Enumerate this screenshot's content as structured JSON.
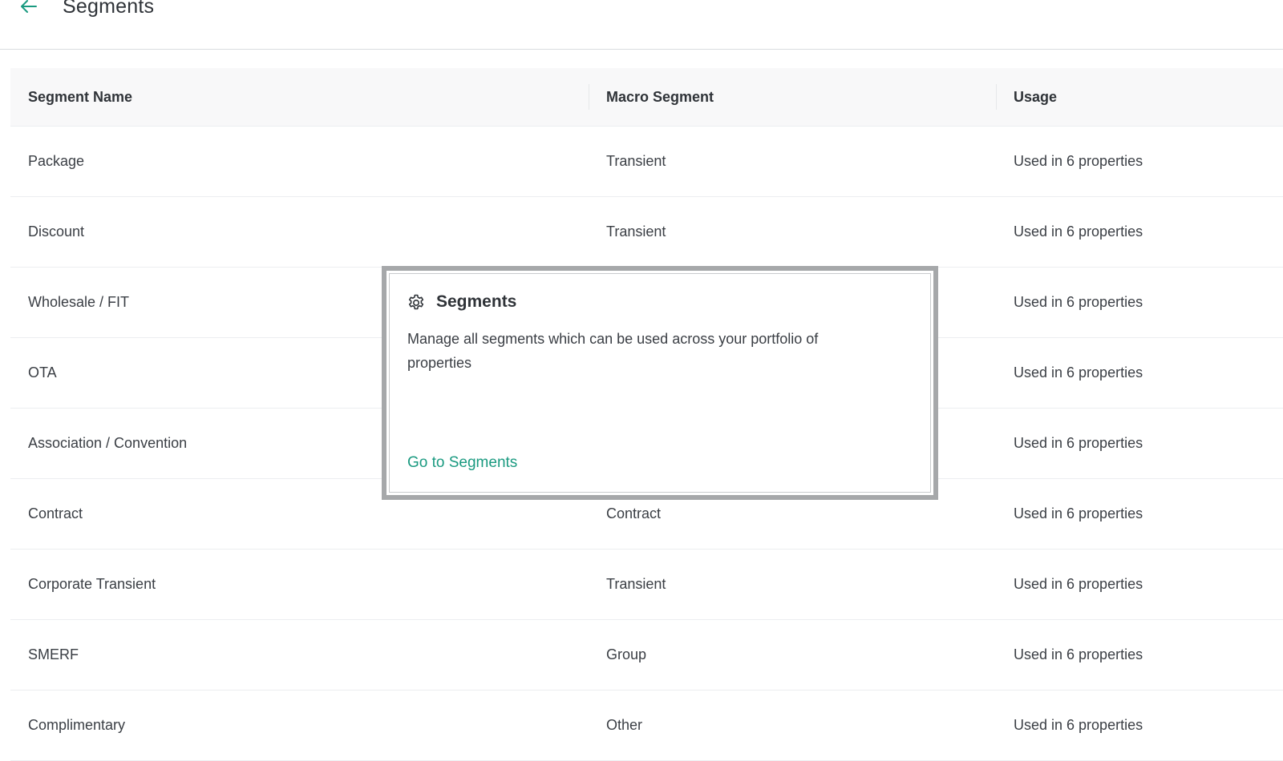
{
  "header": {
    "title": "Segments",
    "back_icon": "arrow-left-icon",
    "accent_color": "#1a9a80"
  },
  "table": {
    "columns": [
      "Segment Name",
      "Macro Segment",
      "Usage"
    ],
    "rows": [
      {
        "name": "Package",
        "macro": "Transient",
        "usage": "Used in 6 properties"
      },
      {
        "name": "Discount",
        "macro": "Transient",
        "usage": "Used in 6 properties"
      },
      {
        "name": "Wholesale / FIT",
        "macro": "",
        "usage": "Used in 6 properties"
      },
      {
        "name": "OTA",
        "macro": "",
        "usage": "Used in 6 properties"
      },
      {
        "name": "Association / Convention",
        "macro": "",
        "usage": "Used in 6 properties"
      },
      {
        "name": "Contract",
        "macro": "Contract",
        "usage": "Used in 6 properties"
      },
      {
        "name": "Corporate Transient",
        "macro": "Transient",
        "usage": "Used in 6 properties"
      },
      {
        "name": "SMERF",
        "macro": "Group",
        "usage": "Used in 6 properties"
      },
      {
        "name": "Complimentary",
        "macro": "Other",
        "usage": "Used in 6 properties"
      }
    ]
  },
  "popover": {
    "icon": "gear-icon",
    "title": "Segments",
    "description": "Manage all segments which can be used across your portfolio of properties",
    "link": "Go to Segments"
  }
}
